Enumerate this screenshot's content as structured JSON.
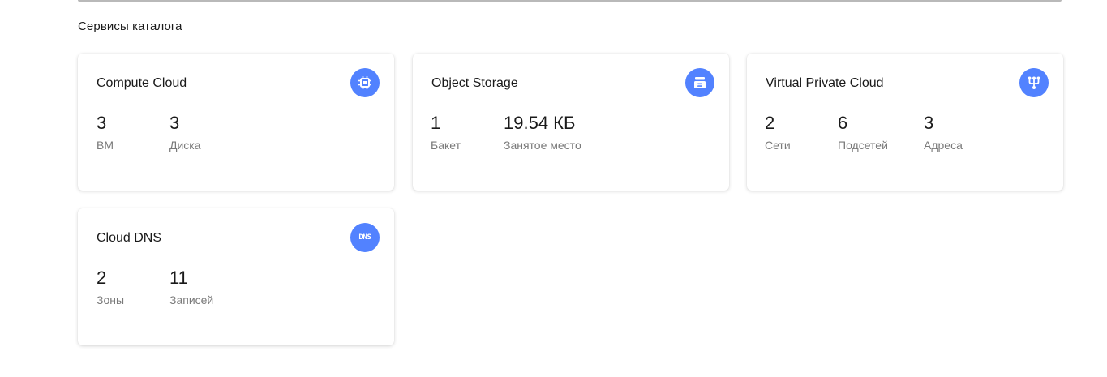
{
  "section": {
    "title": "Сервисы каталога"
  },
  "colors": {
    "icon_bg": "#5282ff",
    "label": "#7a7a7a",
    "text": "#1a1a1a"
  },
  "cards": [
    {
      "title": "Compute Cloud",
      "icon": "chip-icon",
      "stats": [
        {
          "value": "3",
          "label": "ВМ"
        },
        {
          "value": "3",
          "label": "Диска"
        }
      ]
    },
    {
      "title": "Object Storage",
      "icon": "storage-bucket-icon",
      "stats": [
        {
          "value": "1",
          "label": "Бакет"
        },
        {
          "value": "19.54 КБ",
          "label": "Занятое место"
        }
      ]
    },
    {
      "title": "Virtual Private Cloud",
      "icon": "network-icon",
      "stats": [
        {
          "value": "2",
          "label": "Сети"
        },
        {
          "value": "6",
          "label": "Подсетей"
        },
        {
          "value": "3",
          "label": "Адреса"
        }
      ]
    },
    {
      "title": "Cloud DNS",
      "icon": "dns-icon",
      "icon_text": "DNS",
      "stats": [
        {
          "value": "2",
          "label": "Зоны"
        },
        {
          "value": "11",
          "label": "Записей"
        }
      ]
    }
  ]
}
